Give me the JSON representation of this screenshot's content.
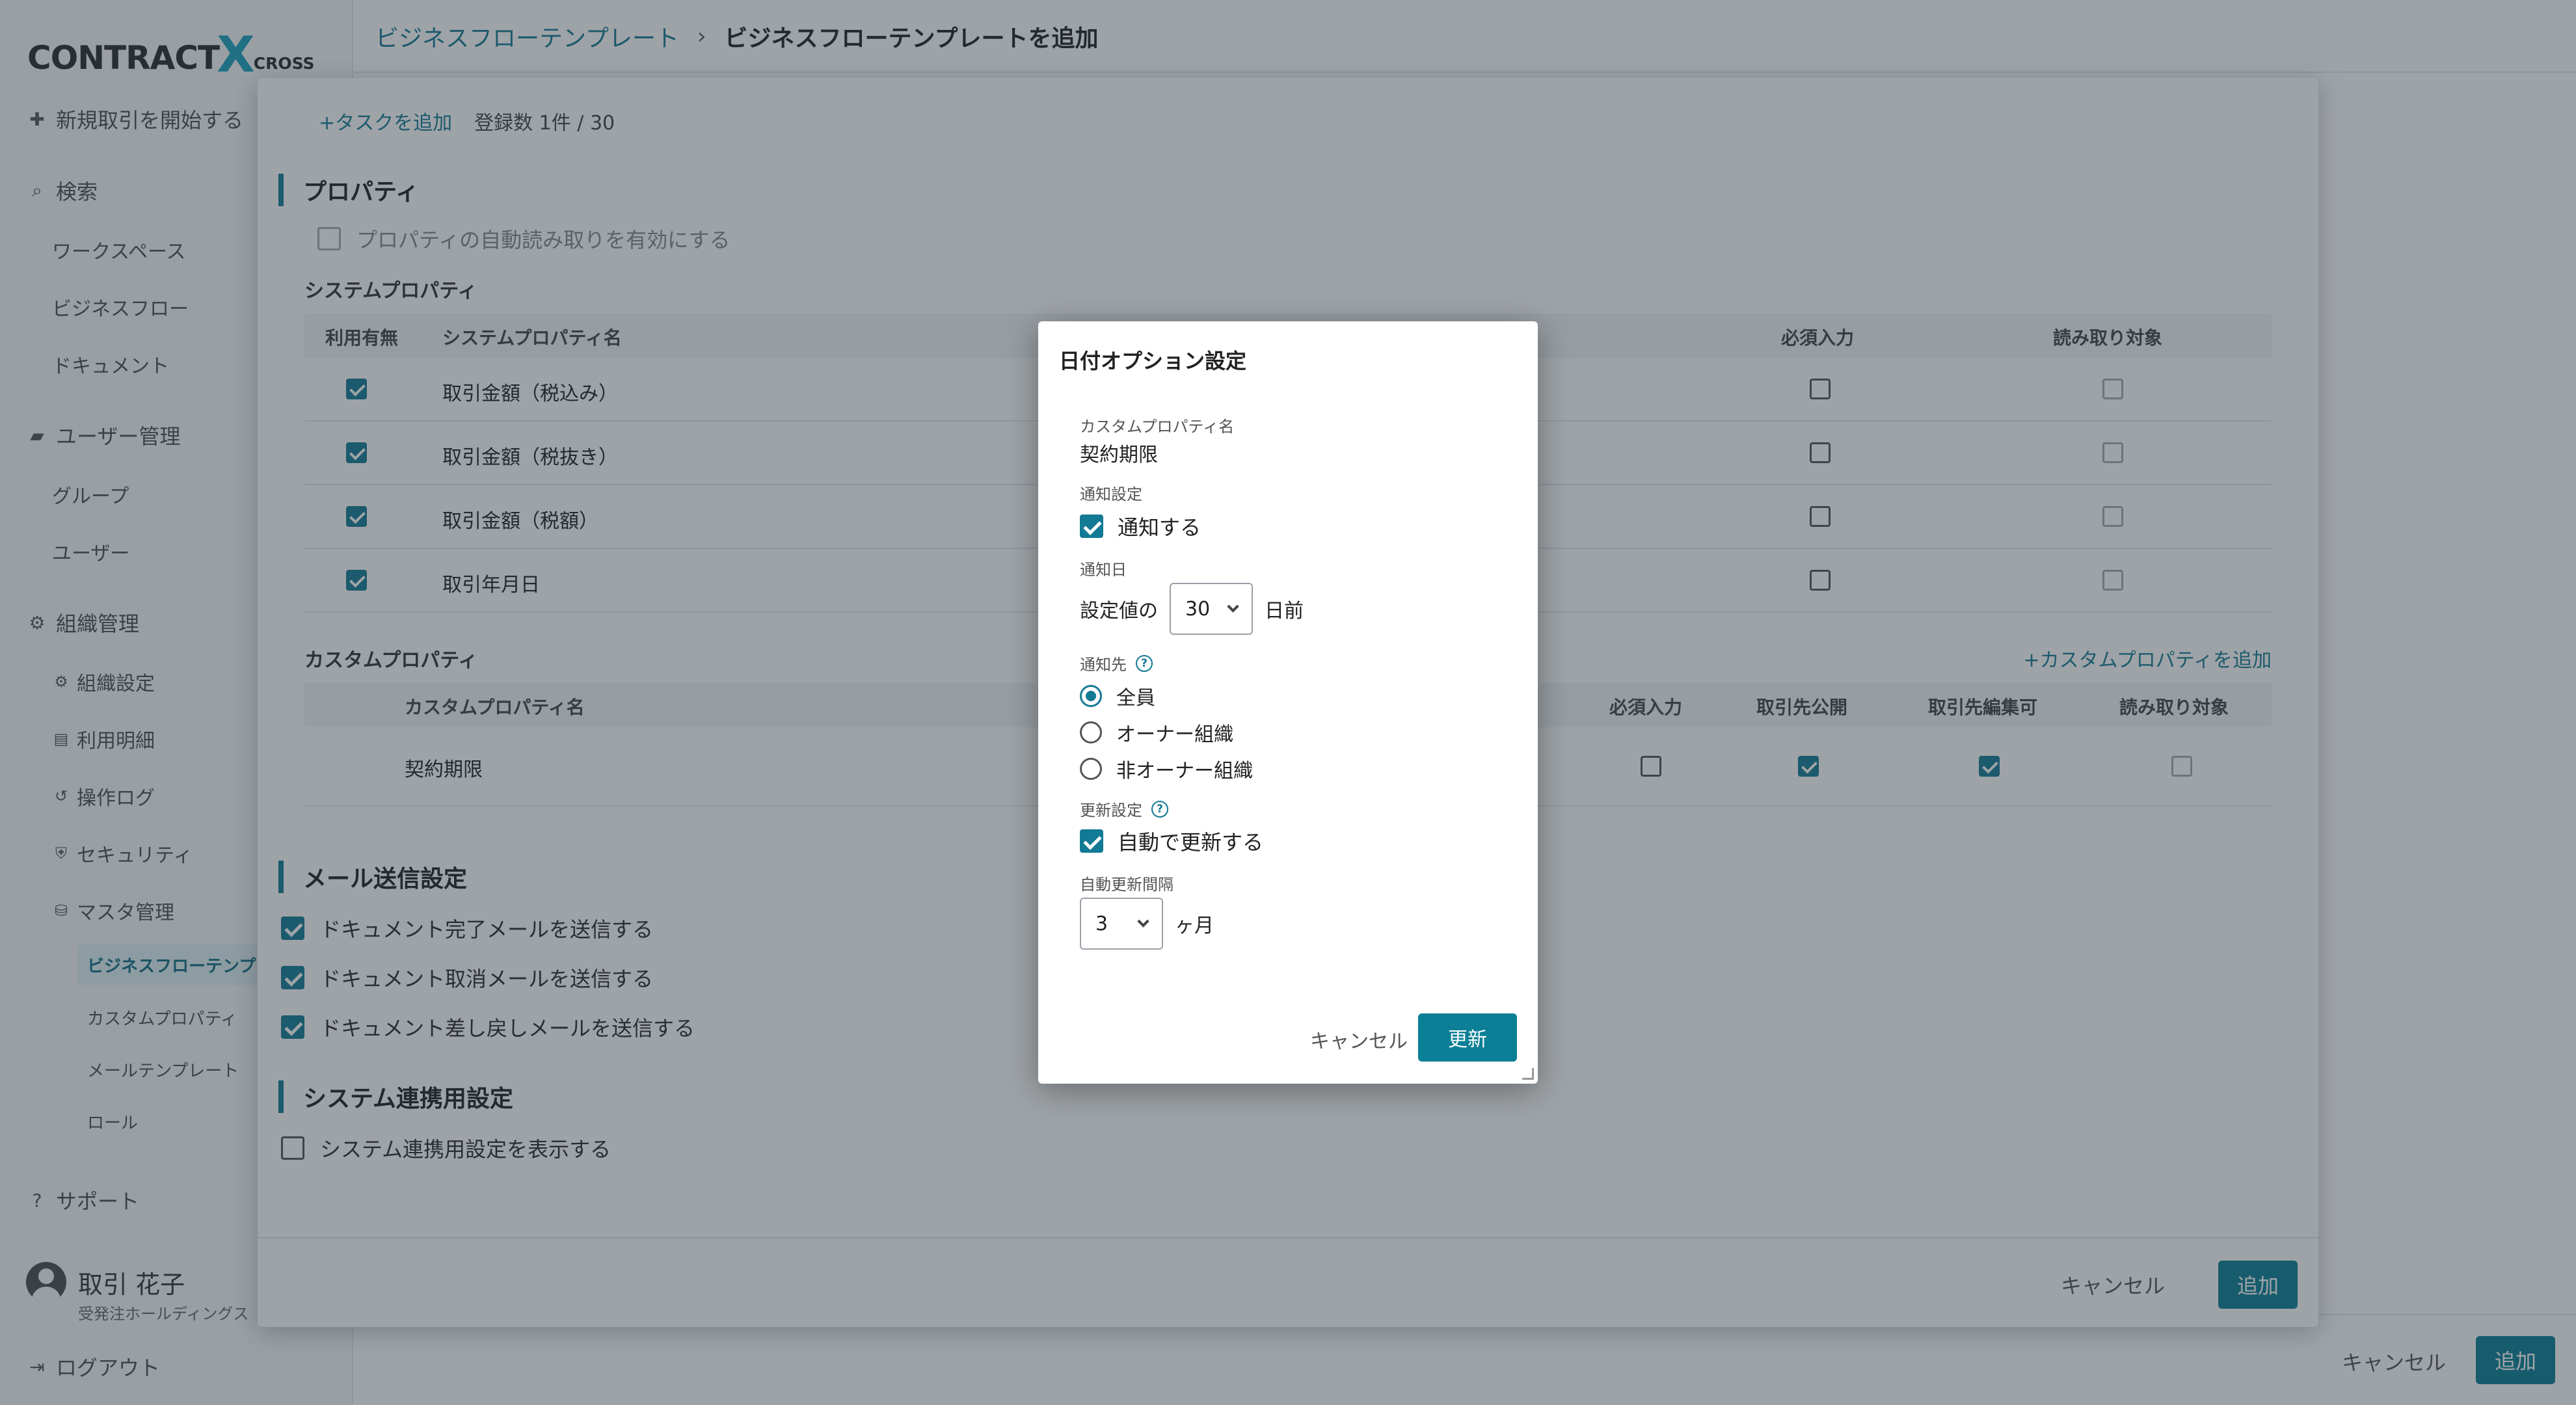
{
  "app": {
    "logo": {
      "main": "CONTRACT",
      "x": "X",
      "sub": "CROSS"
    },
    "breadcrumb": {
      "parent": "ビジネスフローテンプレート",
      "separator": "›",
      "current": "ビジネスフローテンプレートを追加"
    }
  },
  "sidebar": {
    "start_deal": "新規取引を開始する",
    "search": "検索",
    "workspace": "ワークスペース",
    "business_flow": "ビジネスフロー",
    "document": "ドキュメント",
    "user_mgmt": "ユーザー管理",
    "group": "グループ",
    "user": "ユーザー",
    "org_mgmt": "組織管理",
    "org_settings": "組織設定",
    "usage": "利用明細",
    "operation_log": "操作ログ",
    "security": "セキュリティ",
    "master_mgmt": "マスタ管理",
    "bf_template": "ビジネスフローテンプレ",
    "custom_property": "カスタムプロパティ",
    "mail_template": "メールテンプレート",
    "role": "ロール",
    "support": "サポート",
    "user_name": "取引 花子",
    "user_org": "受発注ホールディングス",
    "logout": "ログアウト"
  },
  "page_footer": {
    "cancel": "キャンセル",
    "add": "追加"
  },
  "modal": {
    "add_task": "+タスクを追加",
    "task_count": "登録数 1件 / 30",
    "property_title": "プロパティ",
    "auto_read_label": "プロパティの自動読み取りを有効にする",
    "system_property_title": "システムプロパティ",
    "sys_headers": {
      "use": "利用有無",
      "name": "システムプロパティ名",
      "required": "必須入力",
      "read_target": "読み取り対象"
    },
    "sys_rows": [
      {
        "name": "取引金額（税込み）"
      },
      {
        "name": "取引金額（税抜き）"
      },
      {
        "name": "取引金額（税額）"
      },
      {
        "name": "取引年月日"
      }
    ],
    "custom_property_title": "カスタムプロパティ",
    "add_custom_property": "+カスタムプロパティを追加",
    "custom_headers": {
      "name": "カスタムプロパティ名",
      "required": "必須入力",
      "public": "取引先公開",
      "editable": "取引先編集可",
      "read_target": "読み取り対象"
    },
    "custom_rows": [
      {
        "name": "契約期限"
      }
    ],
    "mail_title": "メール送信設定",
    "mail_complete": "ドキュメント完了メールを送信する",
    "mail_cancel": "ドキュメント取消メールを送信する",
    "mail_return": "ドキュメント差し戻しメールを送信する",
    "integration_title": "システム連携用設定",
    "integration_show": "システム連携用設定を表示する",
    "cancel": "キャンセル",
    "add": "追加"
  },
  "dialog": {
    "title": "日付オプション設定",
    "custom_prop_label": "カスタムプロパティ名",
    "custom_prop_value": "契約期限",
    "notify_setting_label": "通知設定",
    "notify_checkbox": "通知する",
    "notify_day_label": "通知日",
    "notify_prefix": "設定値の",
    "notify_days_value": "30",
    "notify_suffix": "日前",
    "notify_target_label": "通知先",
    "help_glyph": "?",
    "targets": [
      "全員",
      "オーナー組織",
      "非オーナー組織"
    ],
    "selected_target": "全員",
    "renew_setting_label": "更新設定",
    "renew_checkbox": "自動で更新する",
    "renew_interval_label": "自動更新間隔",
    "renew_interval_value": "3",
    "renew_interval_unit": "ヶ月",
    "cancel": "キャンセル",
    "update": "更新"
  },
  "colors": {
    "accent": "#0a7f95",
    "link": "#137a95",
    "overlay": "rgba(40,50,60,0.45)"
  }
}
